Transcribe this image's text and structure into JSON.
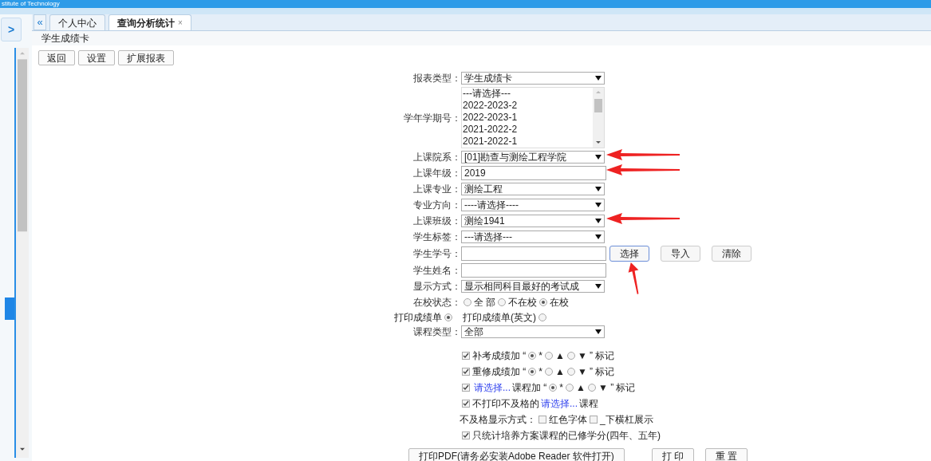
{
  "header": {
    "title": "stitute of Technology"
  },
  "sidebar": {
    "toggle": ">"
  },
  "tabbar": {
    "collapse": "«",
    "tabs": [
      {
        "label": "个人中心",
        "selected": false,
        "closable": false
      },
      {
        "label": "查询分析统计",
        "selected": true,
        "closable": true,
        "close": "×"
      }
    ]
  },
  "page_title": "学生成绩卡",
  "toolbar": [
    "返回",
    "设置",
    "扩展报表"
  ],
  "fields": [
    {
      "kind": "select",
      "label": "报表类型：",
      "value": "学生成绩卡",
      "arrow": false
    },
    {
      "kind": "listbox",
      "label": "学年学期号：",
      "options": [
        "---请选择---",
        "2022-2023-2",
        "2022-2023-1",
        "2021-2022-2",
        "2021-2022-1"
      ],
      "arrow": false
    },
    {
      "kind": "select",
      "label": "上课院系：",
      "value": "[01]勘查与测绘工程学院",
      "arrow": true
    },
    {
      "kind": "text",
      "label": "上课年级：",
      "value": "2019",
      "arrow": true
    },
    {
      "kind": "select",
      "label": "上课专业：",
      "value": "测绘工程",
      "arrow": false
    },
    {
      "kind": "select",
      "label": "专业方向：",
      "value": "----请选择----",
      "arrow": false
    },
    {
      "kind": "select",
      "label": "上课班级：",
      "value": "测绘1941",
      "arrow": true
    },
    {
      "kind": "select",
      "label": "学生标签：",
      "value": "---请选择---",
      "arrow": false
    },
    {
      "kind": "text",
      "label": "学生学号：",
      "arrow": false,
      "buttons": [
        {
          "label": "选择",
          "focused": true,
          "arrow": true
        },
        {
          "label": "导入",
          "focused": false,
          "arrow": false
        },
        {
          "label": "清除",
          "focused": false,
          "arrow": false
        }
      ]
    },
    {
      "kind": "text",
      "label": "学生姓名：",
      "arrow": false
    },
    {
      "kind": "select",
      "label": "显示方式：",
      "value": "显示相同科目最好的考试成",
      "arrow": false
    },
    {
      "kind": "radios",
      "label": "在校状态：",
      "options": [
        {
          "label": "全 部",
          "selected": false
        },
        {
          "label": "不在校",
          "selected": false
        },
        {
          "label": "在校",
          "selected": true
        }
      ],
      "arrow": false
    },
    {
      "kind": "print-radios",
      "options": [
        {
          "label": "打印成绩单",
          "selected": true
        },
        {
          "label": "打印成绩单(英文)",
          "selected": false
        }
      ],
      "arrow": false
    },
    {
      "kind": "select",
      "label": "课程类型：",
      "value": "全部",
      "arrow": false
    }
  ],
  "option_lines": [
    {
      "items": [
        {
          "kind": "checkbox",
          "checked": true
        },
        {
          "kind": "text",
          "text": "补考成绩加 “"
        },
        {
          "kind": "radio",
          "selected": true
        },
        {
          "kind": "text",
          "text": "*"
        },
        {
          "kind": "radio",
          "selected": false
        },
        {
          "kind": "text",
          "text": "▲"
        },
        {
          "kind": "radio",
          "selected": false
        },
        {
          "kind": "text",
          "text": "▼ ” 标记"
        }
      ]
    },
    {
      "items": [
        {
          "kind": "checkbox",
          "checked": true
        },
        {
          "kind": "text",
          "text": "重修成绩加 “"
        },
        {
          "kind": "radio",
          "selected": true
        },
        {
          "kind": "text",
          "text": "*"
        },
        {
          "kind": "radio",
          "selected": false
        },
        {
          "kind": "text",
          "text": "▲"
        },
        {
          "kind": "radio",
          "selected": false
        },
        {
          "kind": "text",
          "text": "▼ ” 标记"
        }
      ]
    },
    {
      "items": [
        {
          "kind": "checkbox",
          "checked": true
        },
        {
          "kind": "link",
          "text": "请选择..."
        },
        {
          "kind": "text",
          "text": "课程加 “"
        },
        {
          "kind": "radio",
          "selected": true
        },
        {
          "kind": "text",
          "text": "*"
        },
        {
          "kind": "radio",
          "selected": false
        },
        {
          "kind": "text",
          "text": "▲"
        },
        {
          "kind": "radio",
          "selected": false
        },
        {
          "kind": "text",
          "text": "▼ ” 标记"
        }
      ]
    },
    {
      "items": [
        {
          "kind": "checkbox",
          "checked": true
        },
        {
          "kind": "text",
          "text": "不打印不及格的"
        },
        {
          "kind": "link",
          "text": "请选择..."
        },
        {
          "kind": "text",
          "text": "课程"
        }
      ]
    },
    {
      "items": [
        {
          "kind": "text",
          "text": "不及格显示方式："
        },
        {
          "kind": "checkbox",
          "checked": false
        },
        {
          "kind": "text",
          "text": "红色字体"
        },
        {
          "kind": "checkbox",
          "checked": false
        },
        {
          "kind": "text",
          "text": "_下横杠展示"
        }
      ]
    },
    {
      "items": [
        {
          "kind": "checkbox",
          "checked": true
        },
        {
          "kind": "text",
          "text": "只统计培养方案课程的已修学分(四年、五年)"
        }
      ]
    }
  ],
  "bottom_buttons": [
    "打印PDF(请务必安装Adobe Reader 软件打开)",
    "打 印",
    "重 置"
  ]
}
